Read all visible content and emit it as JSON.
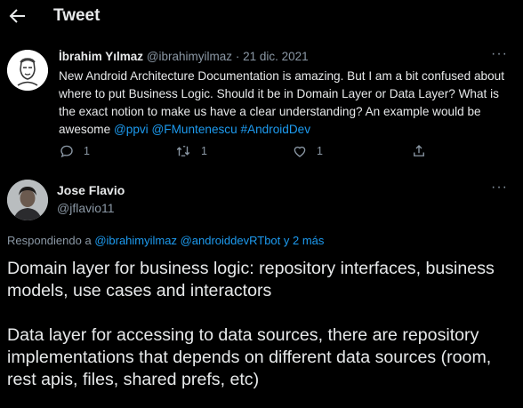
{
  "header": {
    "title": "Tweet",
    "back_icon": "arrow-left-icon"
  },
  "tweet": {
    "author_name": "İbrahim Yılmaz",
    "author_handle": "@ibrahimyilmaz",
    "separator": "·",
    "date": "21 dic. 2021",
    "text_plain": "New Android Architecture Documentation is amazing. But I am a bit confused about where to put Business Logic. Should it be in Domain Layer or Data Layer? What is the exact notion to make us have a clear understanding? An example would be awesome ",
    "mentions": [
      "@ppvi",
      "@FMuntenescu",
      "#AndroidDev"
    ],
    "actions": {
      "replies": "1",
      "retweets": "1",
      "likes": "1"
    }
  },
  "reply": {
    "author_name": "Jose Flavio",
    "author_handle": "@jflavio11",
    "replying_prefix": "Respondiendo a ",
    "replying_to": "@ibrahimyilmaz @androiddevRTbot y 2 más",
    "paragraphs": [
      "Domain layer for business logic: repository interfaces, business models, use cases and interactors",
      "Data layer for accessing to data sources, there are repository implementations that depends on different data sources (room, rest apis, files, shared prefs, etc)"
    ]
  },
  "colors": {
    "background": "#000000",
    "text": "#e7e9ea",
    "muted": "#8b98a5",
    "accent": "#1d9bf0"
  }
}
